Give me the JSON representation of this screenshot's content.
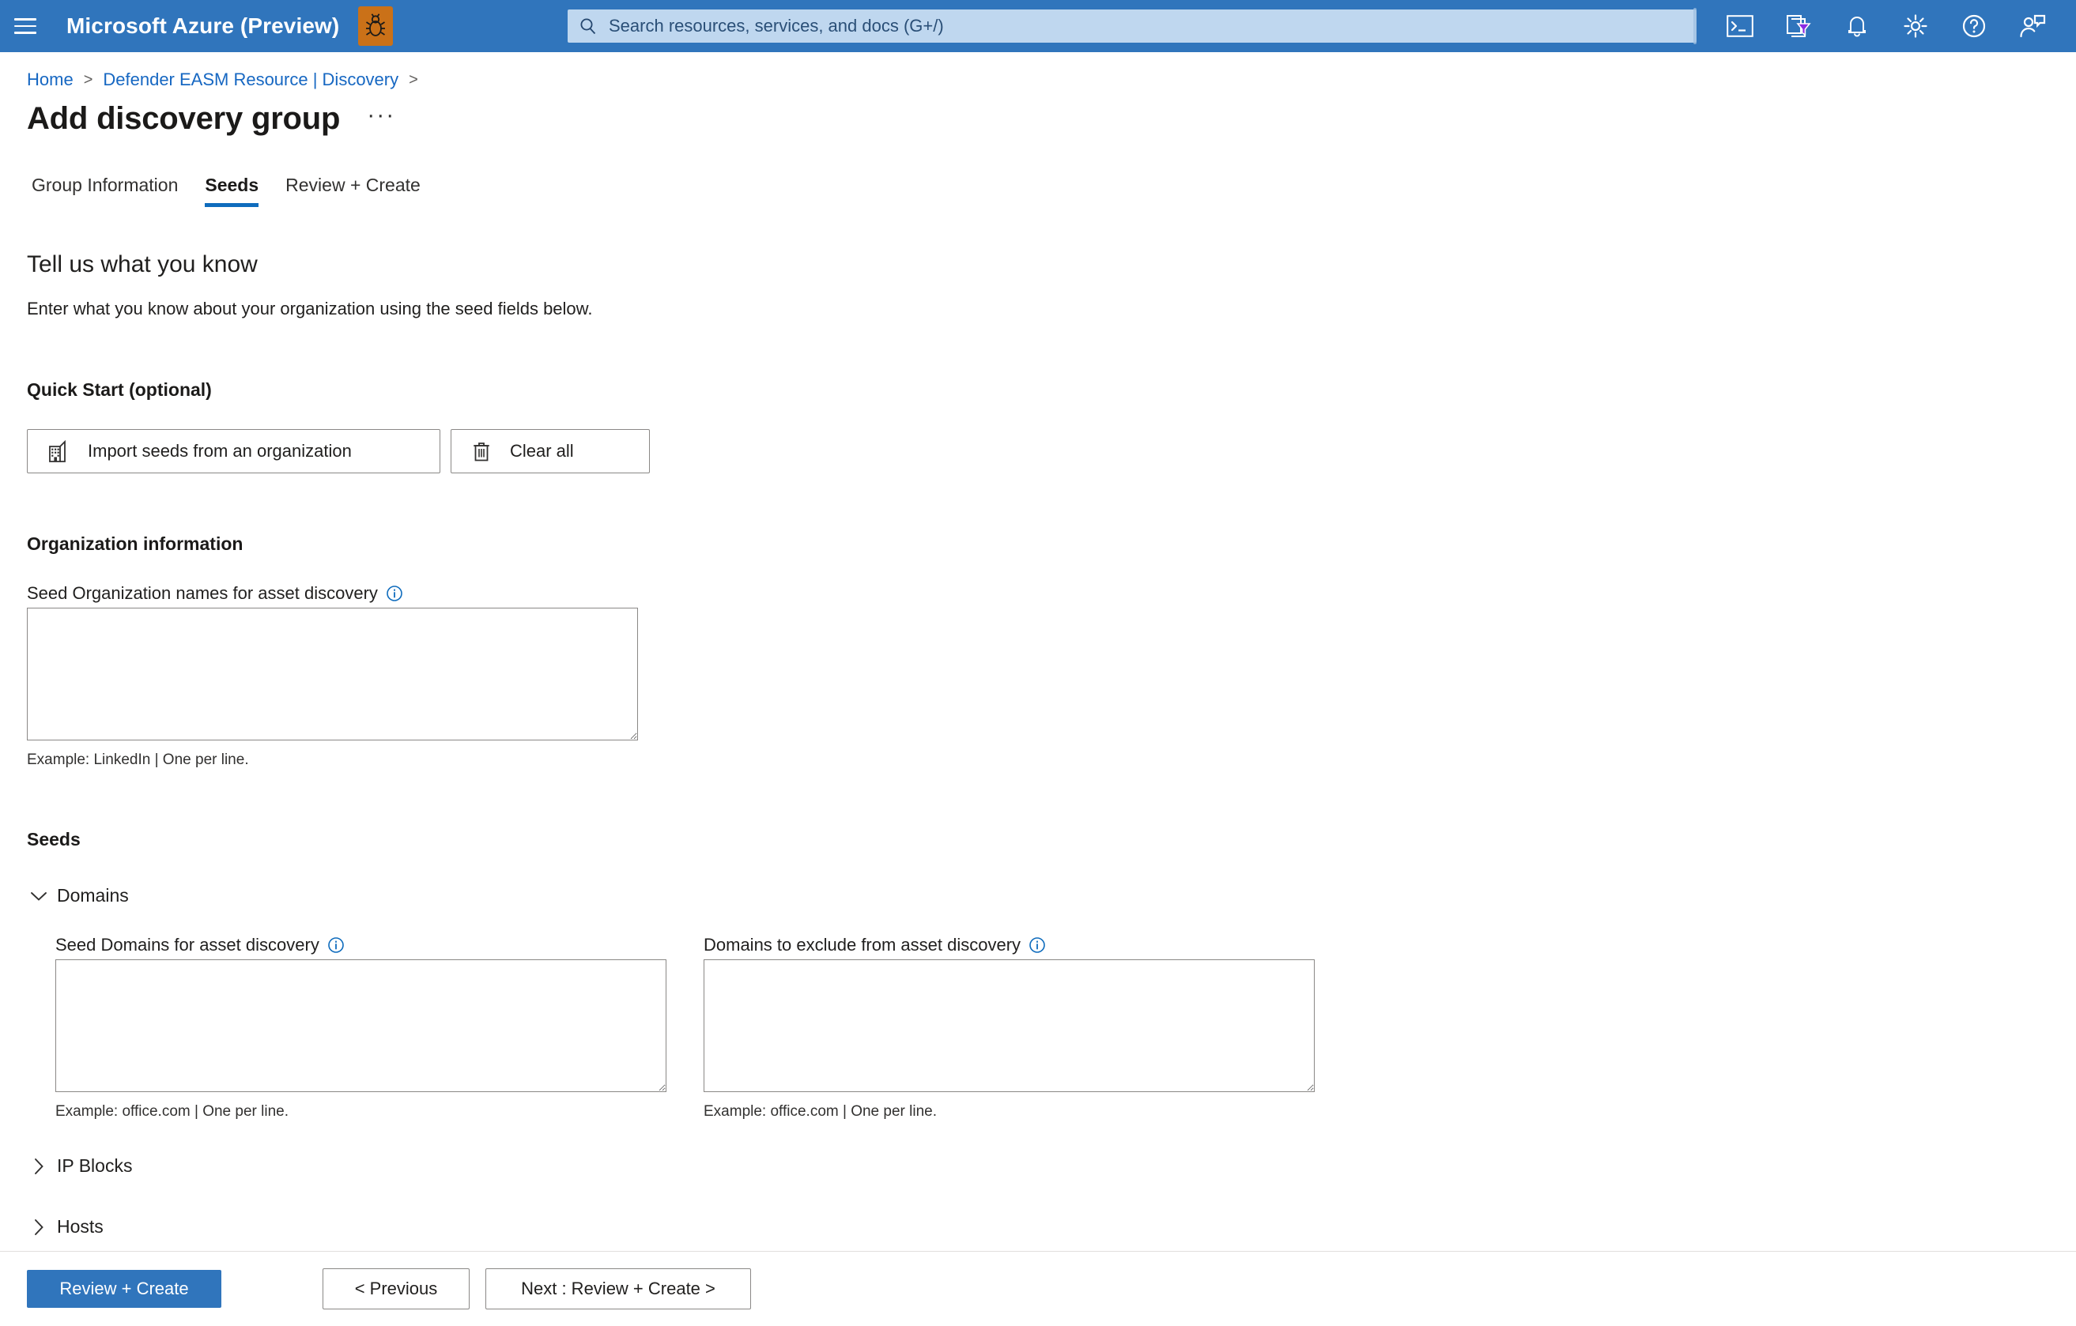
{
  "topbar": {
    "brand": "Microsoft Azure (Preview)",
    "hamburger_name": "menu-icon",
    "bug_icon": "bug-icon",
    "bug_color": "#ca7118",
    "accent_color": "#3075bc",
    "search": {
      "placeholder": "Search resources, services, and docs (G+/)",
      "value": "",
      "icon": "search-icon"
    },
    "icons": [
      {
        "name": "cloud-shell-icon",
        "label": "Cloud Shell"
      },
      {
        "name": "directories-subscriptions-icon",
        "label": "Directories + subscriptions"
      },
      {
        "name": "notifications-bell-icon",
        "label": "Notifications"
      },
      {
        "name": "settings-gear-icon",
        "label": "Settings"
      },
      {
        "name": "help-question-icon",
        "label": "Help"
      },
      {
        "name": "feedback-person-icon",
        "label": "Feedback"
      }
    ]
  },
  "breadcrumb": {
    "items": [
      {
        "label": "Home"
      },
      {
        "label": "Defender EASM Resource | Discovery"
      }
    ],
    "separator": ">"
  },
  "header": {
    "title": "Add discovery group",
    "ellipsis": "···"
  },
  "tabs": [
    {
      "label": "Group Information",
      "active": false
    },
    {
      "label": "Seeds",
      "active": true
    },
    {
      "label": "Review + Create",
      "active": false
    }
  ],
  "main": {
    "section_title": "Tell us what you know",
    "section_subtitle": "Enter what you know about your organization using the seed fields below.",
    "quick_start": {
      "heading": "Quick Start (optional)",
      "import_button": "Import seeds from an organization",
      "import_icon": "organization-building-icon",
      "clear_button": "Clear all",
      "clear_icon": "trash-icon"
    },
    "organization_information": {
      "heading": "Organization information",
      "field_label": "Seed Organization names for asset discovery",
      "info_icon": "info-icon",
      "value": "",
      "placeholder": "",
      "hint": "Example: LinkedIn | One per line."
    },
    "seeds": {
      "heading": "Seeds",
      "sections": [
        {
          "label": "Domains",
          "expanded": true,
          "chevron": "chevron-down-icon",
          "fields": [
            {
              "label": "Seed Domains for asset discovery",
              "info_icon": "info-icon",
              "value": "",
              "placeholder": "",
              "hint": "Example: office.com | One per line."
            },
            {
              "label": "Domains to exclude from asset discovery",
              "info_icon": "info-icon",
              "value": "",
              "placeholder": "",
              "hint": "Example: office.com | One per line."
            }
          ]
        },
        {
          "label": "IP Blocks",
          "expanded": false,
          "chevron": "chevron-right-icon",
          "fields": []
        },
        {
          "label": "Hosts",
          "expanded": false,
          "chevron": "chevron-right-icon",
          "fields": []
        }
      ]
    }
  },
  "footer": {
    "primary_button": "Review + Create",
    "previous_button": "< Previous",
    "next_button": "Next : Review + Create >",
    "primary_color": "#3075bc"
  },
  "colors": {
    "link": "#1667c2",
    "info": "#0f6cbd",
    "border": "#8a8886",
    "tab_underline": "#0f6cbd"
  }
}
